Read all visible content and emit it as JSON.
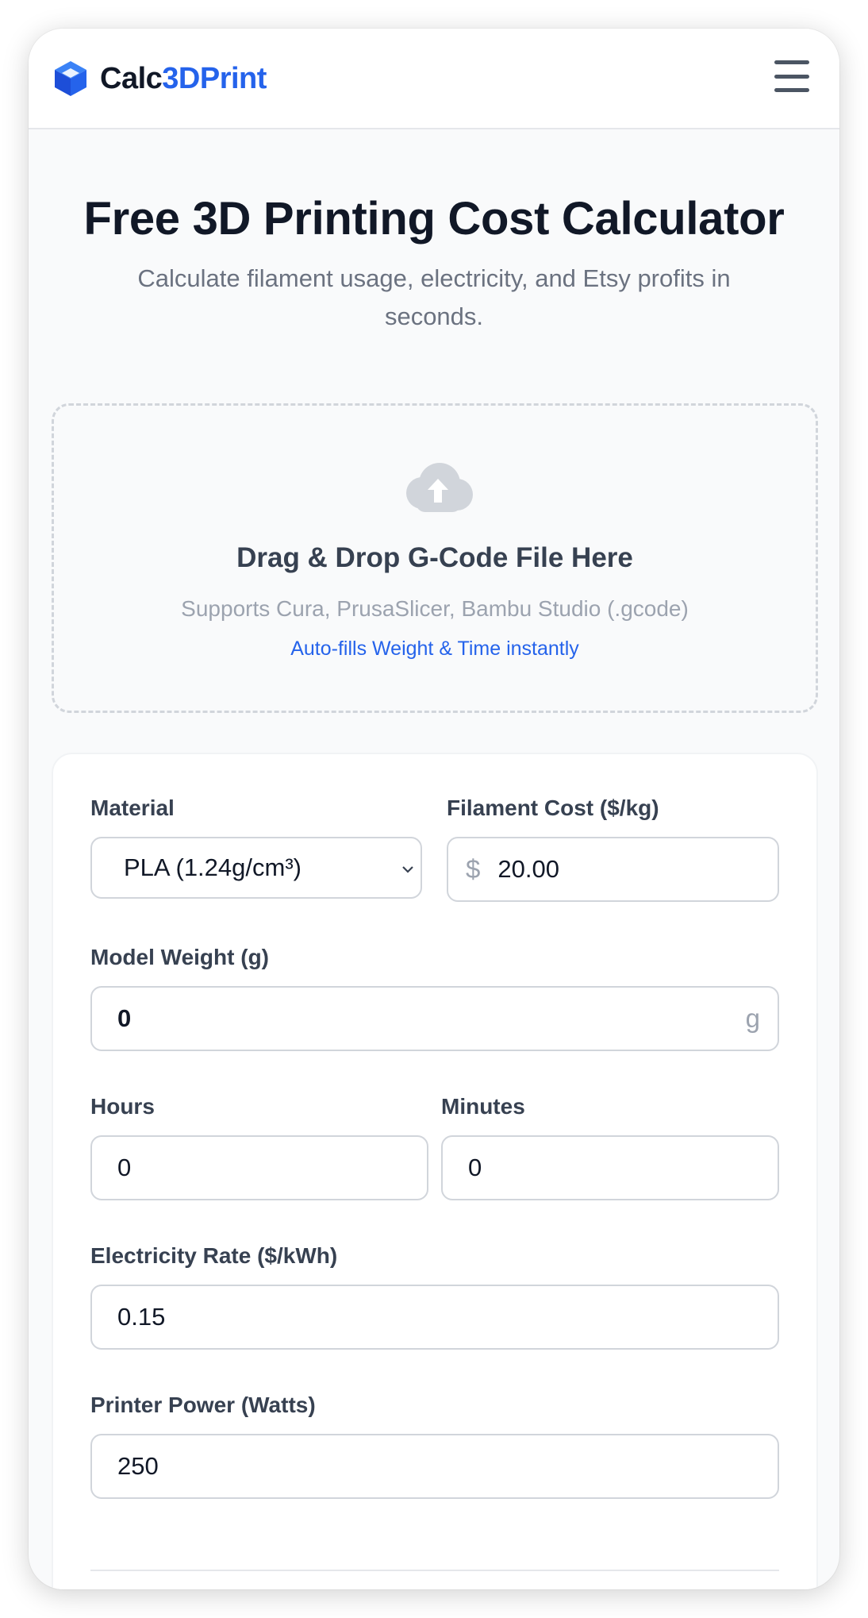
{
  "brand": {
    "name_part1": "Calc",
    "name_part2": "3DPrint",
    "accent_color": "#2563eb",
    "logo_icon": "cube-icon"
  },
  "header": {
    "menu_icon": "hamburger-menu-icon"
  },
  "hero": {
    "title": "Free 3D Printing Cost Calculator",
    "subtitle": "Calculate filament usage, electricity, and Etsy profits in seconds."
  },
  "upload": {
    "icon": "cloud-upload-icon",
    "title": "Drag & Drop G-Code File Here",
    "subtitle": "Supports Cura, PrusaSlicer, Bambu Studio (.gcode)",
    "hint": "Auto-fills Weight & Time instantly"
  },
  "form": {
    "material": {
      "label": "Material",
      "value": "PLA (1.24g/cm³)"
    },
    "filament_cost": {
      "label": "Filament Cost ($/kg)",
      "prefix": "$",
      "value": "20.00"
    },
    "model_weight": {
      "label": "Model Weight (g)",
      "value": "0",
      "suffix": "g"
    },
    "hours": {
      "label": "Hours",
      "value": "0"
    },
    "minutes": {
      "label": "Minutes",
      "value": "0"
    },
    "electricity_rate": {
      "label": "Electricity Rate ($/kWh)",
      "value": "0.15"
    },
    "printer_power": {
      "label": "Printer Power (Watts)",
      "value": "250"
    }
  }
}
